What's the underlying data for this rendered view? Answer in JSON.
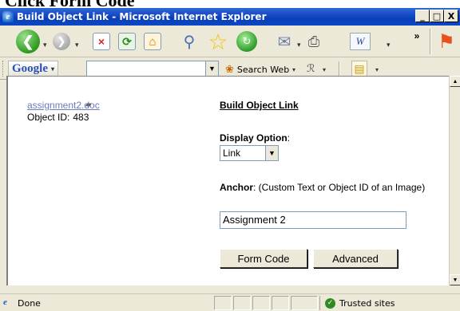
{
  "page_heading_cropped": "Click Form Code",
  "window": {
    "title": "Build Object Link - Microsoft Internet Explorer",
    "minimize": "_",
    "maximize": "□",
    "close": "X"
  },
  "toolbar": {
    "back_icon": "back-arrow-icon",
    "overflow": "»"
  },
  "googlebar": {
    "logo": "Google",
    "search_value": "",
    "search_web_label": "Search Web"
  },
  "content": {
    "file_link": "assignment2.doc",
    "object_id_label": "Object ID:",
    "object_id_value": "483",
    "panel_title": "Build Object Link",
    "display_option_label": "Display Option",
    "display_option_suffix": ":",
    "display_option_selected": "Link",
    "anchor_label": "Anchor",
    "anchor_hint": ": (Custom Text or Object ID of an Image)",
    "anchor_value": "Assignment 2",
    "form_code_button": "Form Code",
    "advanced_button": "Advanced"
  },
  "status": {
    "text": "Done",
    "zone": "Trusted sites"
  }
}
